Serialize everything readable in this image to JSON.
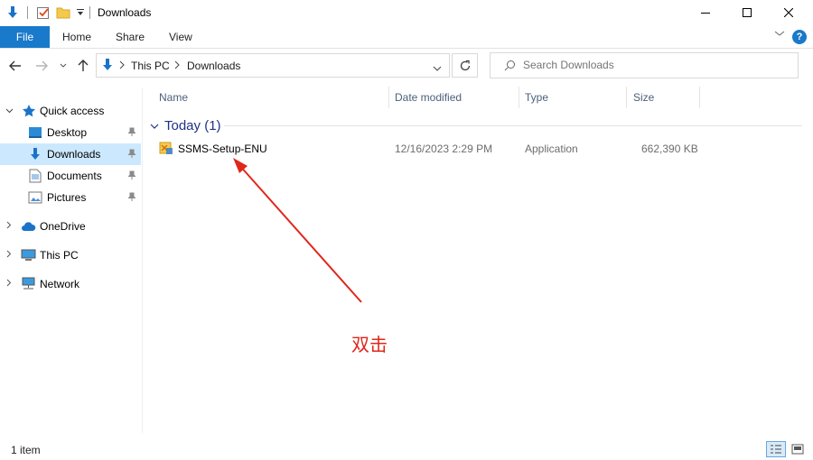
{
  "window": {
    "title": "Downloads"
  },
  "ribbon": {
    "file": "File",
    "tabs": [
      "Home",
      "Share",
      "View"
    ]
  },
  "address": {
    "root": "This PC",
    "folder": "Downloads"
  },
  "search": {
    "placeholder": "Search Downloads"
  },
  "sidebar": {
    "quick_access": "Quick access",
    "items": [
      "Desktop",
      "Downloads",
      "Documents",
      "Pictures"
    ],
    "onedrive": "OneDrive",
    "this_pc": "This PC",
    "network": "Network"
  },
  "columns": {
    "name": "Name",
    "date": "Date modified",
    "type": "Type",
    "size": "Size"
  },
  "group": {
    "label": "Today (1)"
  },
  "files": [
    {
      "name": "SSMS-Setup-ENU",
      "date": "12/16/2023 2:29 PM",
      "type": "Application",
      "size": "662,390 KB"
    }
  ],
  "annotation": {
    "text": "双击"
  },
  "status": {
    "count": "1 item"
  },
  "colors": {
    "accent": "#1979ca",
    "selected": "#cce8ff",
    "annotation_red": "#e0271a",
    "group_blue": "#1e3287"
  }
}
